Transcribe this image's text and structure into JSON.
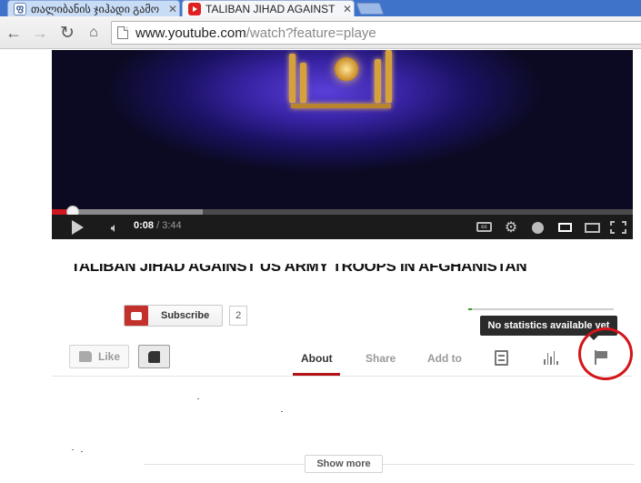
{
  "browser": {
    "tabs": [
      {
        "label": "თალიბანის ჯიჰადი გამო",
        "favicon": "georgian-site-favicon"
      },
      {
        "label": "TALIBAN JIHAD AGAINST",
        "favicon": "youtube-favicon"
      }
    ],
    "url_host": "www.youtube.com",
    "url_path": "/watch?feature=playe"
  },
  "player": {
    "current_time": "0:08",
    "duration": "/ 3:44",
    "played_fraction": 0.036,
    "buffered_fraction": 0.26,
    "icons": [
      "play-icon",
      "volume-icon",
      "captions-icon",
      "settings-gear-icon",
      "watch-later-icon",
      "theater-mode-icon",
      "large-player-icon",
      "fullscreen-icon"
    ]
  },
  "video": {
    "title": "TALIBAN JIHAD AGAINST US ARMY TROOPS IN AFGHANISTAN"
  },
  "subscribe": {
    "label": "Subscribe",
    "count": "2"
  },
  "actions": {
    "like_label": "Like",
    "tabs": [
      "About",
      "Share",
      "Add to"
    ],
    "active_tab": "About",
    "tooltip": "No statistics available yet"
  },
  "description": {
    "show_more": "Show more"
  },
  "colors": {
    "youtube_red": "#cc181e",
    "annotation_circle": "#d41418",
    "tab_strip": "#3f73c9"
  }
}
